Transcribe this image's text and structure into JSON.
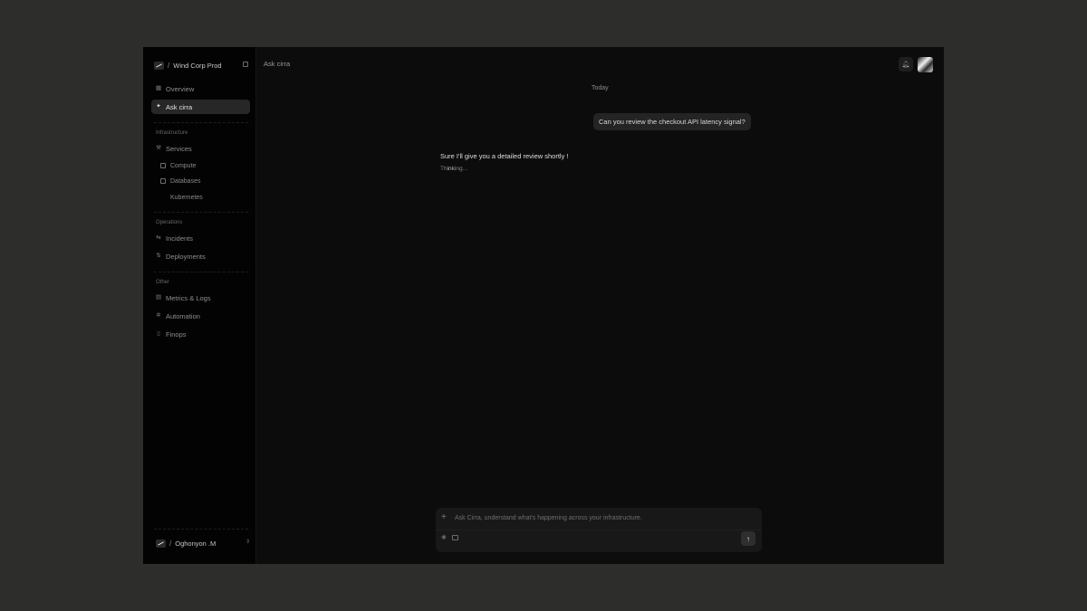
{
  "workspace": {
    "name": "Wind Corp Prod",
    "separator": "/"
  },
  "sidebar": {
    "primary": [
      {
        "label": "Overview",
        "icon": "grid-icon"
      },
      {
        "label": "Ask cirra",
        "icon": "sparkle-icon",
        "active": true
      }
    ],
    "sections": [
      {
        "label": "Infrastructure",
        "items": [
          {
            "label": "Services",
            "icon": "wrench-icon",
            "children": [
              {
                "label": "Compute",
                "icon": "cpu-icon"
              },
              {
                "label": "Databases",
                "icon": "database-icon"
              },
              {
                "label": "Kubernetes",
                "icon": "none"
              }
            ]
          }
        ]
      },
      {
        "label": "Operations",
        "items": [
          {
            "label": "Incidents",
            "icon": "incident-icon"
          },
          {
            "label": "Deployments",
            "icon": "deploy-icon"
          }
        ]
      },
      {
        "label": "Other",
        "items": [
          {
            "label": "Metrics & Logs",
            "icon": "chart-icon"
          },
          {
            "label": "Automation",
            "icon": "automation-icon"
          },
          {
            "label": "Finops",
            "icon": "receipt-icon"
          }
        ]
      }
    ],
    "user": {
      "name": "Oghonyon .M",
      "separator": "/"
    }
  },
  "header": {
    "breadcrumb": "Ask cirra"
  },
  "chat": {
    "day_label": "Today",
    "user_message": "Can you review the checkout API latency signal?",
    "assistant_message": "Sure I'll give you a detailed review shortly !",
    "status": "Thinking..."
  },
  "composer": {
    "placeholder": "Ask Cirra, understand what's happening across your infrastructure.",
    "send_icon": "arrow-up-icon"
  },
  "colors": {
    "page_bg": "#2d2d2b",
    "window_bg": "#0d0c0c",
    "sidebar_bg": "#030303",
    "active_item_bg": "#272727",
    "bubble_bg": "#242424",
    "composer_bg": "#181818"
  }
}
